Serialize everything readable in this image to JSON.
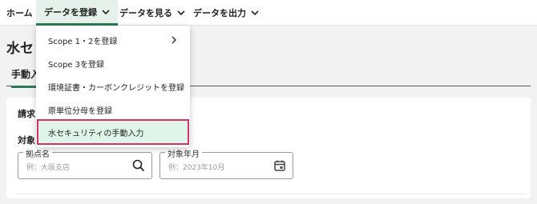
{
  "nav": {
    "items": [
      {
        "label": "ホーム"
      },
      {
        "label": "データを登録"
      },
      {
        "label": "データを見る"
      },
      {
        "label": "データを出力"
      }
    ]
  },
  "page": {
    "title": "水セ",
    "tab_label": "手動入"
  },
  "card": {
    "heading": "請求",
    "filter_label": "対象",
    "fields": {
      "location": {
        "legend": "拠点名",
        "placeholder": "例：大阪支店",
        "icon": "search-icon"
      },
      "period": {
        "legend": "対象年月",
        "placeholder": "例：2023年10月",
        "icon": "calendar-icon"
      }
    }
  },
  "menu": {
    "items": [
      {
        "label": "Scope 1・2を登録",
        "has_submenu": true
      },
      {
        "label": "Scope 3を登録"
      },
      {
        "label": "環境証書・カーボンクレジットを登録"
      },
      {
        "label": "原単位分母を登録"
      },
      {
        "label": "水セキュリティの手動入力",
        "highlighted": true
      }
    ]
  },
  "colors": {
    "accent": "#2b7a55",
    "highlight_bg": "#dff5ea",
    "highlight_border": "#d5306e"
  }
}
